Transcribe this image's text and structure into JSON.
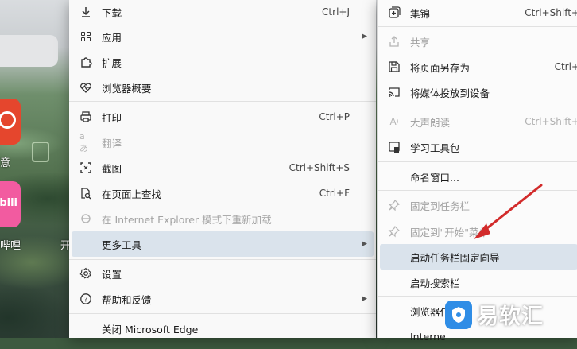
{
  "background": {
    "labels": [
      "意",
      "哔哩",
      "开"
    ],
    "tile_texts": [
      "",
      "bili"
    ]
  },
  "main_menu": {
    "items": [
      {
        "label": "下载",
        "shortcut": "Ctrl+J",
        "icon": "download-icon"
      },
      {
        "label": "应用",
        "submenu": true,
        "icon": "apps-icon"
      },
      {
        "label": "扩展",
        "icon": "extensions-icon"
      },
      {
        "label": "浏览器概要",
        "icon": "heartbeat-icon"
      },
      {
        "label": "打印",
        "shortcut": "Ctrl+P",
        "icon": "printer-icon"
      },
      {
        "label": "翻译",
        "disabled": true,
        "icon": "translate-icon"
      },
      {
        "label": "截图",
        "shortcut": "Ctrl+Shift+S",
        "icon": "screenshot-icon"
      },
      {
        "label": "在页面上查找",
        "shortcut": "Ctrl+F",
        "icon": "find-icon"
      },
      {
        "label": "在 Internet Explorer 模式下重新加载",
        "disabled": true,
        "icon": "ie-icon"
      },
      {
        "label": "更多工具",
        "submenu": true,
        "highlighted": true
      },
      {
        "label": "设置",
        "icon": "gear-icon"
      },
      {
        "label": "帮助和反馈",
        "submenu": true,
        "icon": "help-icon"
      },
      {
        "label": "关闭 Microsoft Edge"
      }
    ]
  },
  "sub_menu": {
    "items": [
      {
        "label": "集锦",
        "shortcut": "Ctrl+Shift+",
        "icon": "collections-icon"
      },
      {
        "label": "共享",
        "disabled": true,
        "icon": "share-icon"
      },
      {
        "label": "将页面另存为",
        "shortcut": "Ctrl+",
        "icon": "save-icon"
      },
      {
        "label": "将媒体投放到设备",
        "icon": "cast-icon"
      },
      {
        "label": "大声朗读",
        "shortcut": "Ctrl+Shift+",
        "disabled": true,
        "icon": "read-aloud-icon"
      },
      {
        "label": "学习工具包",
        "icon": "learning-toolkit-icon"
      },
      {
        "label": "命名窗口..."
      },
      {
        "label": "固定到任务栏",
        "disabled": true,
        "icon": "pin-icon"
      },
      {
        "label": "固定到\"开始\"菜单",
        "disabled": true,
        "icon": "pin-icon"
      },
      {
        "label": "启动任务栏固定向导",
        "highlighted": true
      },
      {
        "label": "启动搜索栏"
      },
      {
        "label": "浏览器任"
      },
      {
        "label": "Interne"
      }
    ]
  },
  "watermark": {
    "text": "易软汇"
  },
  "colors": {
    "highlight": "#dae3ec",
    "annotation_arrow": "#d22b2b",
    "watermark_logo": "#2f8de6"
  }
}
